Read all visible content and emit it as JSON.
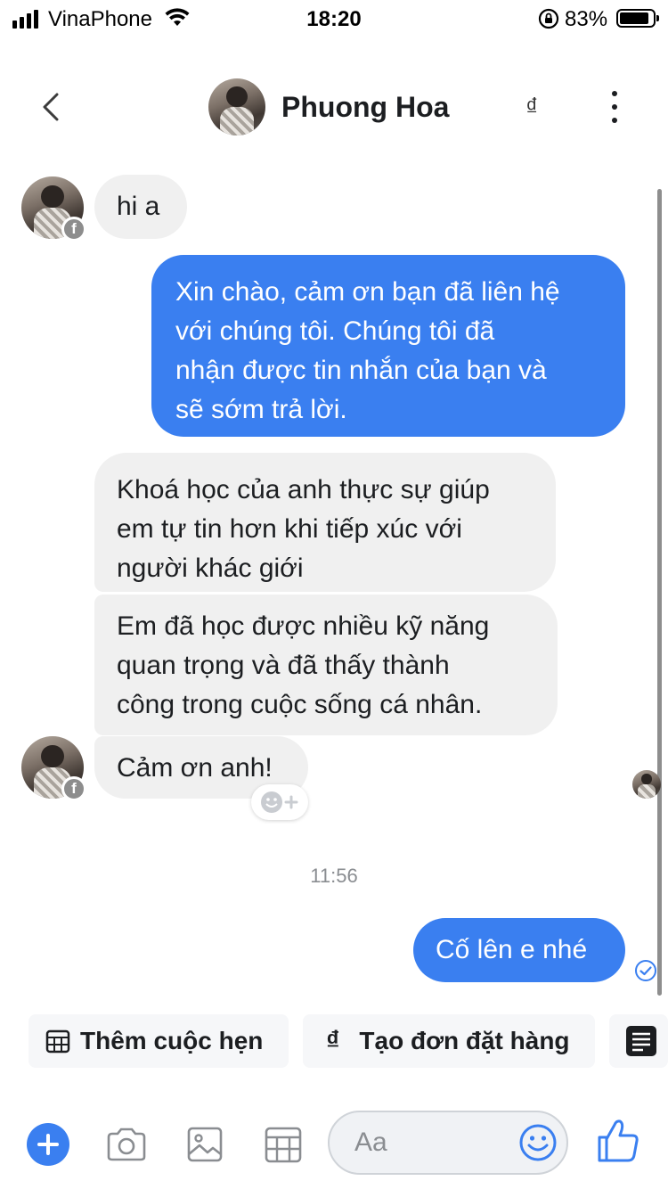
{
  "status_bar": {
    "carrier": "VinaPhone",
    "time": "18:20",
    "battery": "83%",
    "battery_level": 0.83,
    "icons": [
      "signal-icon",
      "wifi-icon",
      "orientation-lock-icon",
      "battery-icon"
    ]
  },
  "header": {
    "contact_name": "Phuong Hoa",
    "currency_symbol": "₫",
    "icons": [
      "back-icon",
      "avatar",
      "dong-icon",
      "more-vertical-icon"
    ]
  },
  "messages": [
    {
      "direction": "incoming",
      "text": "hi a"
    },
    {
      "direction": "outgoing",
      "lines": [
        "Xin chào, cảm ơn bạn đã liên hệ",
        "với chúng tôi. Chúng tôi đã",
        "nhận được tin nhắn của bạn và",
        "sẽ sớm trả lời."
      ]
    },
    {
      "direction": "incoming",
      "lines": [
        "Khoá học của anh thực sự giúp",
        "em tự tin hơn khi tiếp xúc với",
        "người khác giới"
      ]
    },
    {
      "direction": "incoming",
      "lines": [
        "Em đã học được nhiều kỹ năng",
        "quan trọng và đã thấy thành",
        "công trong cuộc sống cá nhân."
      ]
    },
    {
      "direction": "incoming",
      "text": "Cảm ơn anh!"
    },
    {
      "direction": "outgoing",
      "text": "Cố lên e nhé"
    }
  ],
  "timestamp": "11:56",
  "badge": {
    "facebook": "f"
  },
  "quick_replies": [
    {
      "label": "Thêm cuộc hẹn",
      "icon": "calendar-icon"
    },
    {
      "label": "Tạo đơn đặt hàng",
      "icon": "dong-icon",
      "symbol": "₫"
    },
    {
      "label": "",
      "icon": "list-icon"
    }
  ],
  "composer": {
    "placeholder": "Aa",
    "icons": [
      "plus-icon",
      "camera-icon",
      "image-icon",
      "calendar-icon",
      "emoji-icon",
      "thumbs-up-icon"
    ]
  },
  "colors": {
    "accent": "#3a7ff0",
    "incoming_bubble": "#f0f0f0",
    "quick_reply_bg": "#f6f7f9"
  }
}
